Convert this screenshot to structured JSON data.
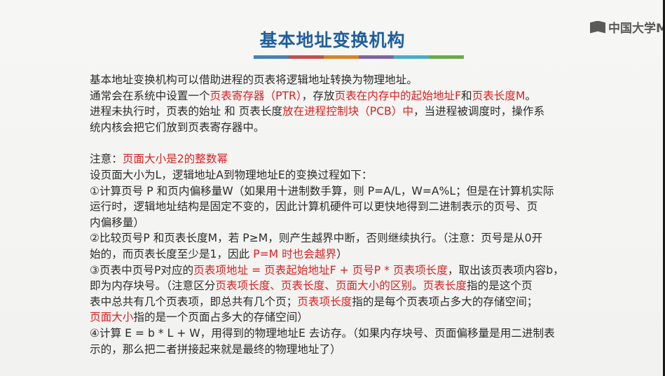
{
  "header": {
    "title": "基本地址变换机构",
    "logo_text": "中国大学M",
    "bar_colors": [
      "#4a7fb5",
      "#c0504d",
      "#d9822b",
      "#8064a2",
      "#4bacc6",
      "#6aa84f"
    ]
  },
  "para1": {
    "l1": "基本地址变换机构可以借助进程的页表将逻辑地址转换为物理地址。",
    "l2_a": "通常会在系统中设置一个",
    "l2_b": "页表寄存器（PTR）",
    "l2_c": "，存放",
    "l2_d": "页表在内存中的起始地址F",
    "l2_e": "和",
    "l2_f": "页表长度M",
    "l2_g": "。",
    "l3_a": "进程未执行时，页表的始址 和 页表长度",
    "l3_b": "放在进程控制块（PCB）中",
    "l3_c": "，当进程被调度时，操作系",
    "l4": "统内核会把它们放到页表寄存器中。"
  },
  "note": {
    "label": "注意：",
    "text": "页面大小是2的整数幂"
  },
  "steps": {
    "intro": "设页面大小为L，逻辑地址A到物理地址E的变换过程如下：",
    "s1_l1": "①计算页号 P 和页内偏移量W（如果用十进制数手算，则 P=A/L，W=A%L；但是在计算机实际",
    "s1_l2": "运行时，逻辑地址结构是固定不变的，因此计算机硬件可以更快地得到二进制表示的页号、页",
    "s1_l3": "内偏移量）",
    "s2_l1": "②比较页号P 和页表长度M，若 P≥M，则产生越界中断，否则继续执行。（注意：页号是从0开",
    "s2_l2_a": "始的，而页表长度至少是1，因此 ",
    "s2_l2_b": "P=M 时也会越界",
    "s2_l2_c": "）",
    "s3_l1_a": "③页表中页号P对应的",
    "s3_l1_b": "页表项地址 = 页表起始地址F + 页号P * 页表项长度",
    "s3_l1_c": "，取出该页表项内容b，",
    "s3_l2_a": "即为内存块号。（注意区分",
    "s3_l2_b": "页表项长度、页表长度、页面大小的区别",
    "s3_l2_c": "。",
    "s3_l2_d": "页表长度",
    "s3_l2_e": "指的是这个页",
    "s3_l3_a": "表中总共有几个页表项，即总共有几个页；",
    "s3_l3_b": "页表项长度",
    "s3_l3_c": "指的是每个页表项占多大的存储空间；",
    "s3_l4_a": "页面大小",
    "s3_l4_b": "指的是一个页面占多大的存储空间）",
    "s4_l1": "④计算 E = b * L + W，用得到的物理地址E 去访存。（如果内存块号、页面偏移量是用二进制表",
    "s4_l2": "示的，那么把二者拼接起来就是最终的物理地址了）"
  }
}
